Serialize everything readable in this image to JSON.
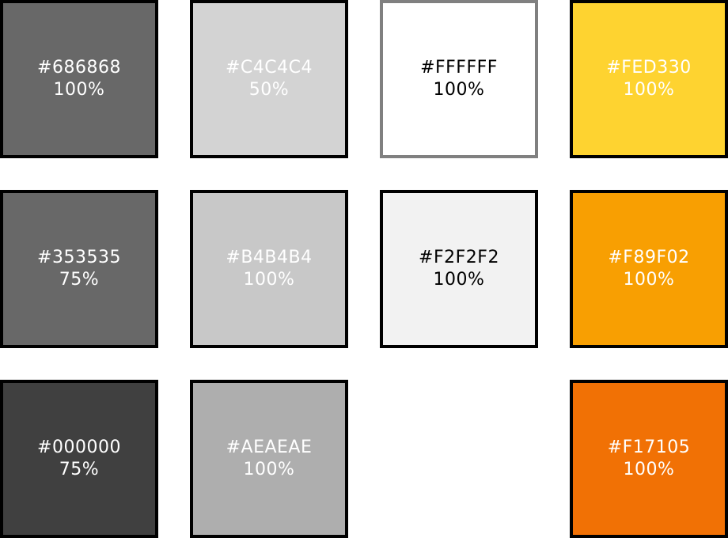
{
  "swatches": [
    {
      "id": "686868",
      "hex_label": "#686868",
      "opacity_label": "100%",
      "fill": "#686868",
      "border": "#000000",
      "text_color": "#ffffff",
      "row": 0,
      "col": 0
    },
    {
      "id": "c4c4c4",
      "hex_label": "#C4C4C4",
      "opacity_label": "50%",
      "fill": "#d3d3d3",
      "border": "#000000",
      "text_color": "#ffffff",
      "row": 0,
      "col": 1
    },
    {
      "id": "ffffff",
      "hex_label": "#FFFFFF",
      "opacity_label": "100%",
      "fill": "#ffffff",
      "border": "#808080",
      "text_color": "#000000",
      "row": 0,
      "col": 2
    },
    {
      "id": "fed330",
      "hex_label": "#FED330",
      "opacity_label": "100%",
      "fill": "#fed330",
      "border": "#000000",
      "text_color": "#ffffff",
      "row": 0,
      "col": 3
    },
    {
      "id": "353535",
      "hex_label": "#353535",
      "opacity_label": "75%",
      "fill": "#686868",
      "border": "#000000",
      "text_color": "#ffffff",
      "row": 1,
      "col": 0
    },
    {
      "id": "b4b4b4",
      "hex_label": "#B4B4B4",
      "opacity_label": "100%",
      "fill": "#c8c8c8",
      "border": "#000000",
      "text_color": "#ffffff",
      "row": 1,
      "col": 1
    },
    {
      "id": "f2f2f2",
      "hex_label": "#F2F2F2",
      "opacity_label": "100%",
      "fill": "#f2f2f2",
      "border": "#000000",
      "text_color": "#000000",
      "row": 1,
      "col": 2
    },
    {
      "id": "f89f02",
      "hex_label": "#F89F02",
      "opacity_label": "100%",
      "fill": "#f89f02",
      "border": "#000000",
      "text_color": "#ffffff",
      "row": 1,
      "col": 3
    },
    {
      "id": "000000",
      "hex_label": "#000000",
      "opacity_label": "75%",
      "fill": "#404040",
      "border": "#000000",
      "text_color": "#ffffff",
      "row": 2,
      "col": 0
    },
    {
      "id": "aeaeae",
      "hex_label": "#AEAEAE",
      "opacity_label": "100%",
      "fill": "#aeaeae",
      "border": "#000000",
      "text_color": "#ffffff",
      "row": 2,
      "col": 1
    },
    {
      "id": "f17105",
      "hex_label": "#F17105",
      "opacity_label": "100%",
      "fill": "#f17105",
      "border": "#000000",
      "text_color": "#ffffff",
      "row": 2,
      "col": 3
    }
  ]
}
